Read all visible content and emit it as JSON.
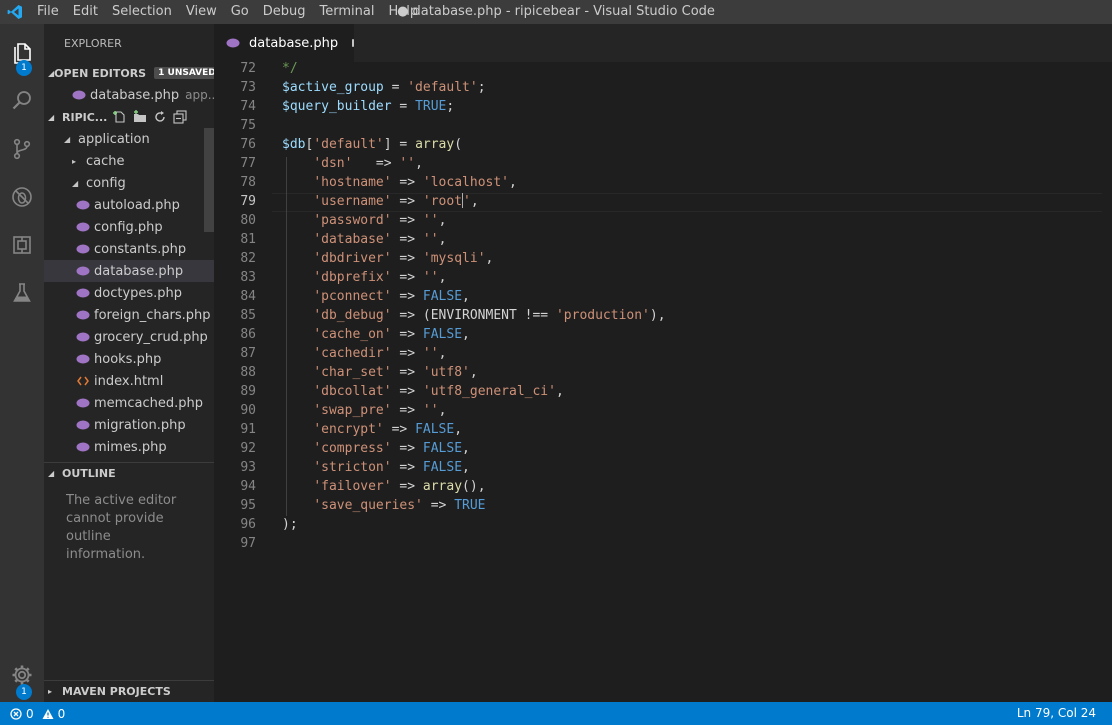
{
  "menu": {
    "items": [
      "File",
      "Edit",
      "Selection",
      "View",
      "Go",
      "Debug",
      "Terminal",
      "Help"
    ],
    "window_title": "● database.php - ripicebear - Visual Studio Code"
  },
  "activity": {
    "explorer_badge": "1",
    "settings_badge": "1"
  },
  "sidebar": {
    "title": "EXPLORER",
    "open_editors": {
      "label": "OPEN EDITORS",
      "badge": "1 UNSAVED",
      "items": [
        {
          "name": "database.php",
          "path": "app..."
        }
      ]
    },
    "project": {
      "label": "RIPIC...",
      "tree": [
        {
          "label": "application",
          "kind": "folder-open",
          "depth": 1
        },
        {
          "label": "cache",
          "kind": "folder-closed",
          "depth": 2
        },
        {
          "label": "config",
          "kind": "folder-open",
          "depth": 2
        },
        {
          "label": "autoload.php",
          "kind": "php",
          "depth": 3
        },
        {
          "label": "config.php",
          "kind": "php",
          "depth": 3
        },
        {
          "label": "constants.php",
          "kind": "php",
          "depth": 3
        },
        {
          "label": "database.php",
          "kind": "php",
          "depth": 3,
          "selected": true
        },
        {
          "label": "doctypes.php",
          "kind": "php",
          "depth": 3
        },
        {
          "label": "foreign_chars.php",
          "kind": "php",
          "depth": 3
        },
        {
          "label": "grocery_crud.php",
          "kind": "php",
          "depth": 3
        },
        {
          "label": "hooks.php",
          "kind": "php",
          "depth": 3
        },
        {
          "label": "index.html",
          "kind": "html",
          "depth": 3
        },
        {
          "label": "memcached.php",
          "kind": "php",
          "depth": 3
        },
        {
          "label": "migration.php",
          "kind": "php",
          "depth": 3
        },
        {
          "label": "mimes.php",
          "kind": "php",
          "depth": 3
        }
      ]
    },
    "outline": {
      "label": "OUTLINE",
      "message": "The active editor cannot provide outline information."
    },
    "maven": {
      "label": "MAVEN PROJECTS"
    }
  },
  "tab": {
    "label": "database.php"
  },
  "editor": {
    "current_line": 79,
    "lines": [
      {
        "n": "72",
        "tokens": [
          {
            "t": "*/",
            "c": "c"
          }
        ]
      },
      {
        "n": "73",
        "tokens": [
          {
            "t": "$active_group",
            "c": "v"
          },
          {
            "t": " = ",
            "c": ""
          },
          {
            "t": "'default'",
            "c": "s"
          },
          {
            "t": ";",
            "c": ""
          }
        ]
      },
      {
        "n": "74",
        "tokens": [
          {
            "t": "$query_builder",
            "c": "v"
          },
          {
            "t": " = ",
            "c": ""
          },
          {
            "t": "TRUE",
            "c": "k"
          },
          {
            "t": ";",
            "c": ""
          }
        ]
      },
      {
        "n": "75",
        "tokens": []
      },
      {
        "n": "76",
        "tokens": [
          {
            "t": "$db",
            "c": "v"
          },
          {
            "t": "[",
            "c": ""
          },
          {
            "t": "'default'",
            "c": "s"
          },
          {
            "t": "] = ",
            "c": ""
          },
          {
            "t": "array",
            "c": "f"
          },
          {
            "t": "(",
            "c": ""
          }
        ]
      },
      {
        "n": "77",
        "tokens": [
          {
            "t": "    ",
            "c": ""
          },
          {
            "t": "'dsn'",
            "c": "s"
          },
          {
            "t": "   => ",
            "c": ""
          },
          {
            "t": "''",
            "c": "s"
          },
          {
            "t": ",",
            "c": ""
          }
        ]
      },
      {
        "n": "78",
        "tokens": [
          {
            "t": "    ",
            "c": ""
          },
          {
            "t": "'hostname'",
            "c": "s"
          },
          {
            "t": " => ",
            "c": ""
          },
          {
            "t": "'localhost'",
            "c": "s"
          },
          {
            "t": ",",
            "c": ""
          }
        ]
      },
      {
        "n": "79",
        "tokens": [
          {
            "t": "    ",
            "c": ""
          },
          {
            "t": "'username'",
            "c": "s"
          },
          {
            "t": " => ",
            "c": ""
          },
          {
            "t": "'root",
            "c": "s"
          },
          {
            "t": "|",
            "c": "caret"
          },
          {
            "t": "'",
            "c": "s"
          },
          {
            "t": ",",
            "c": ""
          }
        ]
      },
      {
        "n": "80",
        "tokens": [
          {
            "t": "    ",
            "c": ""
          },
          {
            "t": "'password'",
            "c": "s"
          },
          {
            "t": " => ",
            "c": ""
          },
          {
            "t": "''",
            "c": "s"
          },
          {
            "t": ",",
            "c": ""
          }
        ]
      },
      {
        "n": "81",
        "tokens": [
          {
            "t": "    ",
            "c": ""
          },
          {
            "t": "'database'",
            "c": "s"
          },
          {
            "t": " => ",
            "c": ""
          },
          {
            "t": "''",
            "c": "s"
          },
          {
            "t": ",",
            "c": ""
          }
        ]
      },
      {
        "n": "82",
        "tokens": [
          {
            "t": "    ",
            "c": ""
          },
          {
            "t": "'dbdriver'",
            "c": "s"
          },
          {
            "t": " => ",
            "c": ""
          },
          {
            "t": "'mysqli'",
            "c": "s"
          },
          {
            "t": ",",
            "c": ""
          }
        ]
      },
      {
        "n": "83",
        "tokens": [
          {
            "t": "    ",
            "c": ""
          },
          {
            "t": "'dbprefix'",
            "c": "s"
          },
          {
            "t": " => ",
            "c": ""
          },
          {
            "t": "''",
            "c": "s"
          },
          {
            "t": ",",
            "c": ""
          }
        ]
      },
      {
        "n": "84",
        "tokens": [
          {
            "t": "    ",
            "c": ""
          },
          {
            "t": "'pconnect'",
            "c": "s"
          },
          {
            "t": " => ",
            "c": ""
          },
          {
            "t": "FALSE",
            "c": "k"
          },
          {
            "t": ",",
            "c": ""
          }
        ]
      },
      {
        "n": "85",
        "tokens": [
          {
            "t": "    ",
            "c": ""
          },
          {
            "t": "'db_debug'",
            "c": "s"
          },
          {
            "t": " => (ENVIRONMENT !== ",
            "c": ""
          },
          {
            "t": "'production'",
            "c": "s"
          },
          {
            "t": "),",
            "c": ""
          }
        ]
      },
      {
        "n": "86",
        "tokens": [
          {
            "t": "    ",
            "c": ""
          },
          {
            "t": "'cache_on'",
            "c": "s"
          },
          {
            "t": " => ",
            "c": ""
          },
          {
            "t": "FALSE",
            "c": "k"
          },
          {
            "t": ",",
            "c": ""
          }
        ]
      },
      {
        "n": "87",
        "tokens": [
          {
            "t": "    ",
            "c": ""
          },
          {
            "t": "'cachedir'",
            "c": "s"
          },
          {
            "t": " => ",
            "c": ""
          },
          {
            "t": "''",
            "c": "s"
          },
          {
            "t": ",",
            "c": ""
          }
        ]
      },
      {
        "n": "88",
        "tokens": [
          {
            "t": "    ",
            "c": ""
          },
          {
            "t": "'char_set'",
            "c": "s"
          },
          {
            "t": " => ",
            "c": ""
          },
          {
            "t": "'utf8'",
            "c": "s"
          },
          {
            "t": ",",
            "c": ""
          }
        ]
      },
      {
        "n": "89",
        "tokens": [
          {
            "t": "    ",
            "c": ""
          },
          {
            "t": "'dbcollat'",
            "c": "s"
          },
          {
            "t": " => ",
            "c": ""
          },
          {
            "t": "'utf8_general_ci'",
            "c": "s"
          },
          {
            "t": ",",
            "c": ""
          }
        ]
      },
      {
        "n": "90",
        "tokens": [
          {
            "t": "    ",
            "c": ""
          },
          {
            "t": "'swap_pre'",
            "c": "s"
          },
          {
            "t": " => ",
            "c": ""
          },
          {
            "t": "''",
            "c": "s"
          },
          {
            "t": ",",
            "c": ""
          }
        ]
      },
      {
        "n": "91",
        "tokens": [
          {
            "t": "    ",
            "c": ""
          },
          {
            "t": "'encrypt'",
            "c": "s"
          },
          {
            "t": " => ",
            "c": ""
          },
          {
            "t": "FALSE",
            "c": "k"
          },
          {
            "t": ",",
            "c": ""
          }
        ]
      },
      {
        "n": "92",
        "tokens": [
          {
            "t": "    ",
            "c": ""
          },
          {
            "t": "'compress'",
            "c": "s"
          },
          {
            "t": " => ",
            "c": ""
          },
          {
            "t": "FALSE",
            "c": "k"
          },
          {
            "t": ",",
            "c": ""
          }
        ]
      },
      {
        "n": "93",
        "tokens": [
          {
            "t": "    ",
            "c": ""
          },
          {
            "t": "'stricton'",
            "c": "s"
          },
          {
            "t": " => ",
            "c": ""
          },
          {
            "t": "FALSE",
            "c": "k"
          },
          {
            "t": ",",
            "c": ""
          }
        ]
      },
      {
        "n": "94",
        "tokens": [
          {
            "t": "    ",
            "c": ""
          },
          {
            "t": "'failover'",
            "c": "s"
          },
          {
            "t": " => ",
            "c": ""
          },
          {
            "t": "array",
            "c": "f"
          },
          {
            "t": "(),",
            "c": ""
          }
        ]
      },
      {
        "n": "95",
        "tokens": [
          {
            "t": "    ",
            "c": ""
          },
          {
            "t": "'save_queries'",
            "c": "s"
          },
          {
            "t": " => ",
            "c": ""
          },
          {
            "t": "TRUE",
            "c": "k"
          }
        ]
      },
      {
        "n": "96",
        "tokens": [
          {
            "t": ");",
            "c": ""
          }
        ]
      },
      {
        "n": "97",
        "tokens": []
      }
    ]
  },
  "status": {
    "errors": "0",
    "warnings": "0",
    "position": "Ln 79, Col 24"
  },
  "colors": {
    "accent": "#007acc",
    "php_icon": "#a074c4",
    "html_icon": "#e37933",
    "new_file": "#89d185"
  }
}
